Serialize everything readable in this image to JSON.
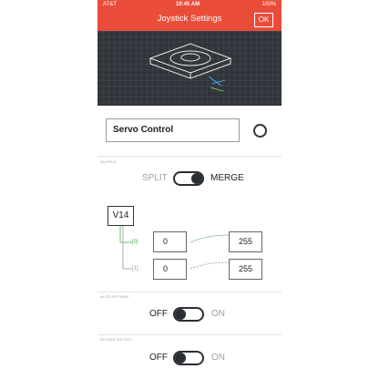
{
  "status_bar": {
    "carrier": "AT&T",
    "time": "10:45 AM",
    "battery": "100%"
  },
  "header": {
    "title": "Joystick Settings",
    "ok_label": "OK"
  },
  "widget_name": "Servo Control",
  "output": {
    "section_label": "OUTPUT",
    "split_label": "SPLIT",
    "merge_label": "MERGE",
    "mode": "MERGE",
    "pin": "V14",
    "channels": [
      {
        "index": "[0]",
        "min": "0",
        "max": "255"
      },
      {
        "index": "[1]",
        "min": "0",
        "max": "255"
      }
    ]
  },
  "auto_return": {
    "section_label": "AUTO RETURN",
    "off_label": "OFF",
    "on_label": "ON",
    "state": "OFF"
  },
  "rotate_on_tilt": {
    "section_label": "ROTATE ON TILT",
    "off_label": "OFF",
    "on_label": "ON",
    "state": "OFF"
  },
  "colors": {
    "accent": "#e94d3a",
    "dark": "#2a2e33",
    "preview_bg": "#30353b",
    "link_green": "#4caf50"
  }
}
